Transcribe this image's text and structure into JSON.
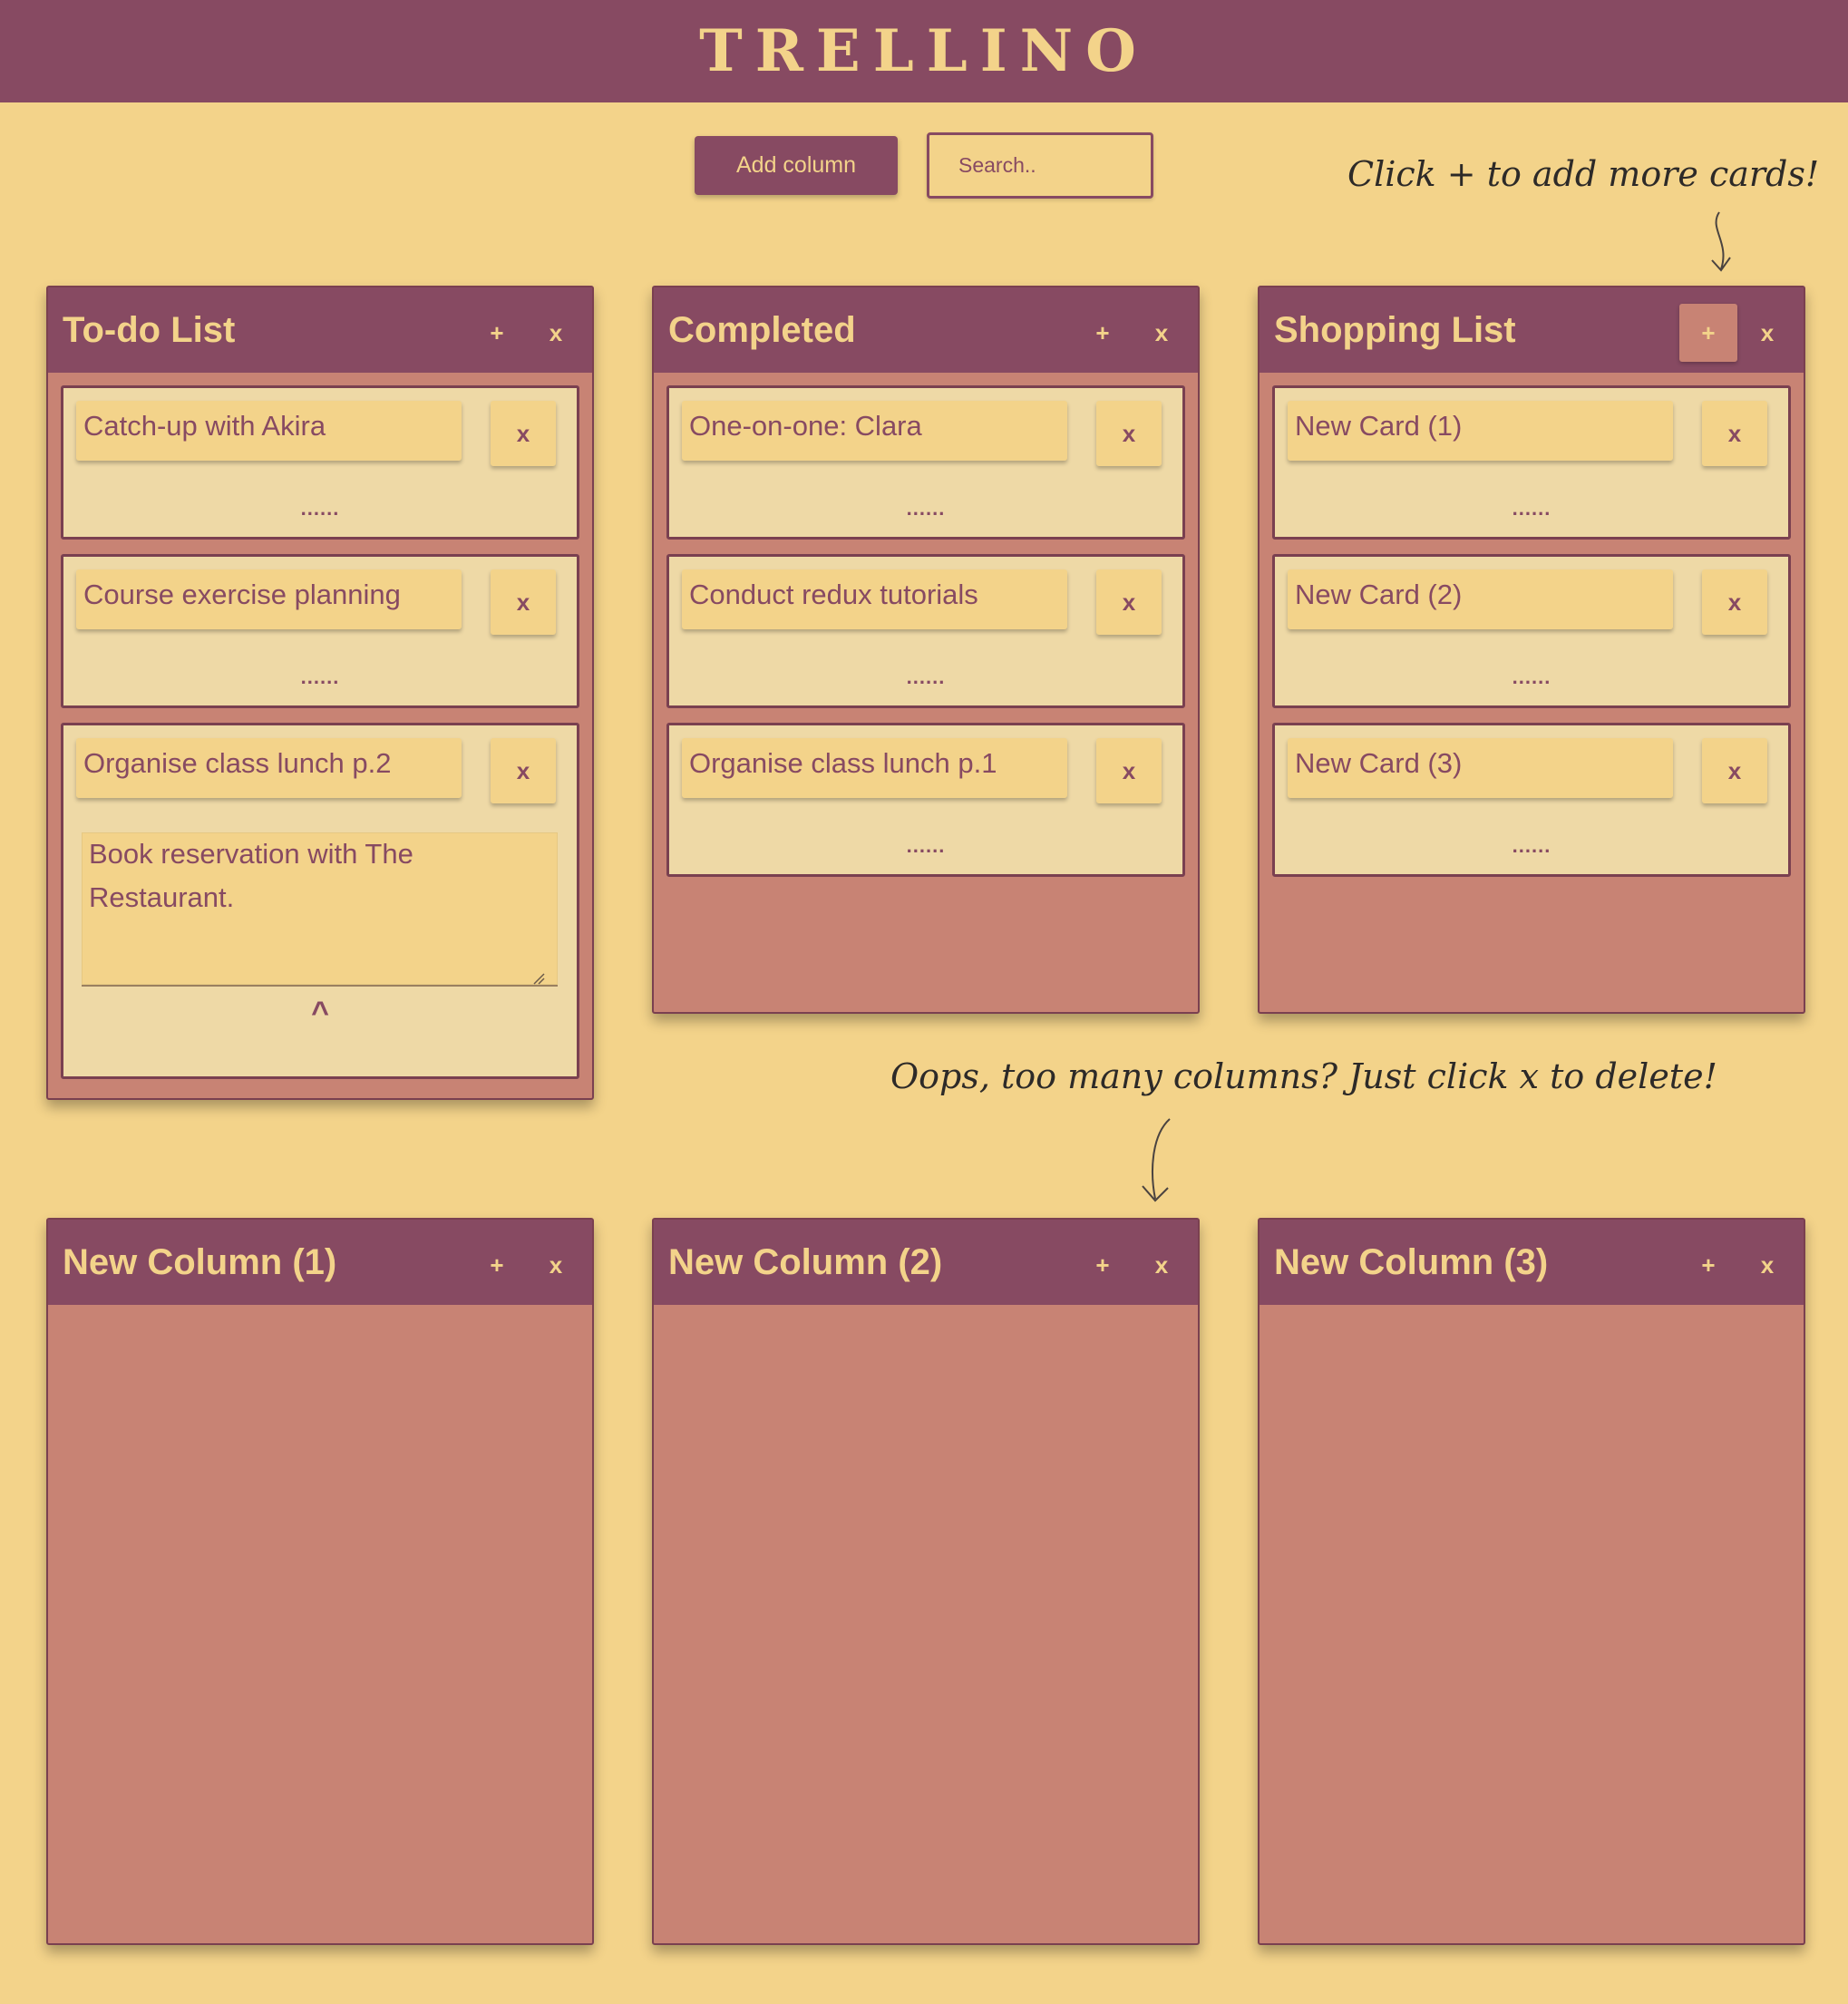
{
  "app": {
    "title": "TRELLINO"
  },
  "toolbar": {
    "add_column_label": "Add column",
    "search_placeholder": "Search.."
  },
  "hints": {
    "add_cards": "Click + to add more cards!",
    "delete_columns": "Oops, too many columns? Just click x to delete!"
  },
  "icons": {
    "plus": "+",
    "close": "x",
    "more": "......",
    "collapse": "^"
  },
  "columns": [
    {
      "title": "To-do List",
      "cards": [
        {
          "title": "Catch-up with Akira"
        },
        {
          "title": "Course exercise planning"
        },
        {
          "title": "Organise class lunch p.2",
          "description": "Book reservation with The Restaurant."
        }
      ]
    },
    {
      "title": "Completed",
      "cards": [
        {
          "title": "One-on-one: Clara"
        },
        {
          "title": "Conduct redux tutorials"
        },
        {
          "title": "Organise class lunch p.1"
        }
      ]
    },
    {
      "title": "Shopping List",
      "cards": [
        {
          "title": "New Card (1)"
        },
        {
          "title": "New Card (2)"
        },
        {
          "title": "New Card (3)"
        }
      ]
    },
    {
      "title": "New Column (1)",
      "cards": []
    },
    {
      "title": "New Column (2)",
      "cards": []
    },
    {
      "title": "New Column (3)",
      "cards": []
    }
  ],
  "colors": {
    "header": "#874a62",
    "background": "#f3d38a",
    "column_body": "#c88374",
    "card": "#eed9a6"
  }
}
